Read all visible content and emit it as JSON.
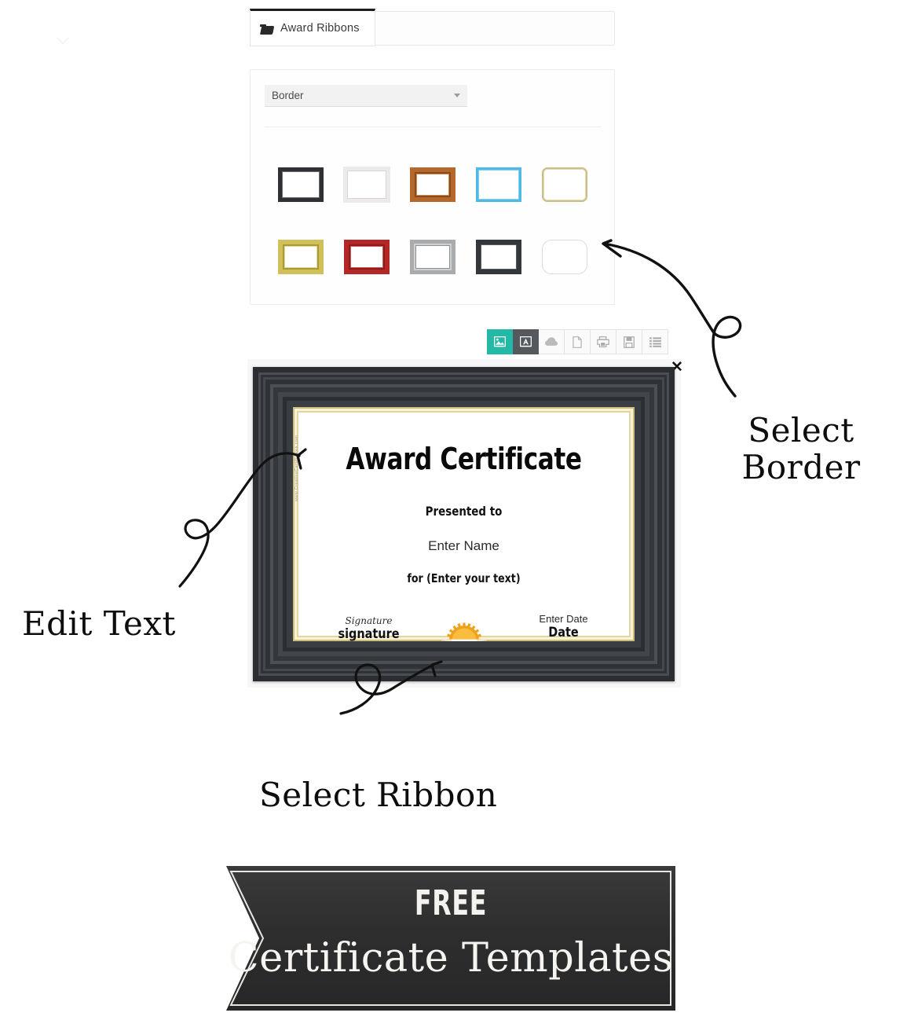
{
  "tab": {
    "icon": "folder-icon",
    "label": "Award Ribbons"
  },
  "picker": {
    "select": {
      "value": "Border",
      "caret_icon": "chevron-down-icon"
    },
    "thumbnails": [
      {
        "name": "black-frame",
        "color": "#2e3033"
      },
      {
        "name": "white-frame",
        "color": "#eceaea"
      },
      {
        "name": "wood-frame",
        "color": "#b5682c"
      },
      {
        "name": "blue-frame",
        "color": "#4cb9e6"
      },
      {
        "name": "gold-ornate-frame",
        "color": "#c9bf8a"
      },
      {
        "name": "gold-frame",
        "color": "#cfc05a"
      },
      {
        "name": "red-frame",
        "color": "#b32726"
      },
      {
        "name": "silver-frame",
        "color": "#a9abad"
      },
      {
        "name": "charcoal-frame",
        "color": "#33363a"
      },
      {
        "name": "rounded-outline-frame",
        "color": "#dcdcdc"
      }
    ]
  },
  "toolbar": {
    "buttons": [
      {
        "name": "image-icon",
        "state": "active-teal"
      },
      {
        "name": "text-icon",
        "state": "active-dark"
      },
      {
        "name": "cloud-icon",
        "state": "default"
      },
      {
        "name": "document-icon",
        "state": "default"
      },
      {
        "name": "print-icon",
        "state": "default"
      },
      {
        "name": "save-icon",
        "state": "default"
      },
      {
        "name": "list-icon",
        "state": "default"
      }
    ],
    "active_accent": "#22b9a6",
    "active_dark": "#55585c"
  },
  "certificate": {
    "close_label": "✕",
    "watermark": "www.CreativeCertificates.com",
    "title": "Award Certificate",
    "presented_to": "Presented to",
    "name_placeholder": "Enter Name",
    "for_line": "for (Enter your text)",
    "signature_script": "Signature",
    "signature_label": "signature",
    "date_placeholder": "Enter Date",
    "date_label": "Date",
    "seal": "gold-ribbon-seal",
    "frame_color": "#2b2d30",
    "mat_color": "#cdbf79"
  },
  "annotations": {
    "border": "Select\nBorder",
    "border_line1": "Select",
    "border_line2": "Border",
    "edit_text": "Edit Text",
    "ribbon": "Select Ribbon"
  },
  "banner": {
    "free": "FREE",
    "subtitle": "Certificate Templates",
    "background": "#303030"
  }
}
